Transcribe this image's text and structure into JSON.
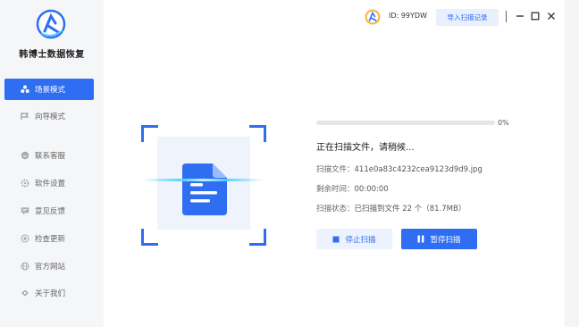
{
  "app": {
    "name": "韩博士数据恢复"
  },
  "sidebar": {
    "items": [
      {
        "label": "场景模式",
        "icon": "scene-icon",
        "active": true
      },
      {
        "label": "向导模式",
        "icon": "wizard-icon"
      },
      {
        "label": "联系客服",
        "icon": "support-icon"
      },
      {
        "label": "软件设置",
        "icon": "settings-icon"
      },
      {
        "label": "意见反馈",
        "icon": "feedback-icon"
      },
      {
        "label": "检查更新",
        "icon": "update-icon"
      },
      {
        "label": "官方网站",
        "icon": "website-icon"
      },
      {
        "label": "关于我们",
        "icon": "about-icon"
      }
    ]
  },
  "header": {
    "user_id": "ID: 99YDW",
    "import_label": "导入扫描记录"
  },
  "scan": {
    "progress_fraction": 0.0,
    "progress_text": "0%",
    "status_title": "正在扫描文件，请稍候...",
    "file_label": "扫描文件：",
    "file_value": "411e0a83c4232cea9123d9d9.jpg",
    "remaining_label": "剩余时间：",
    "remaining_value": "00:00:00",
    "state_label": "扫描状态：",
    "state_value": "已扫描到文件 22 个（81.7MB）",
    "stop_label": "停止扫描",
    "pause_label": "暂停扫描"
  },
  "colors": {
    "accent": "#2f6ef2",
    "sidebar_bg": "#f5f6f8",
    "scan_glow": "#4ad2ff"
  }
}
